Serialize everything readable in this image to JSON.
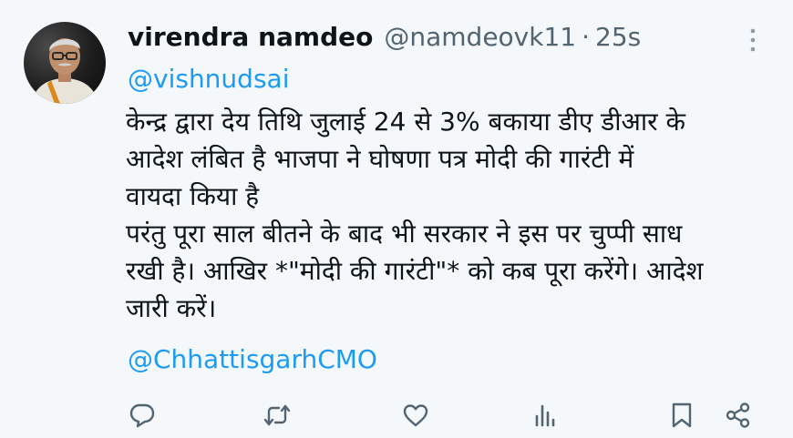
{
  "tweet": {
    "author_name": "virendra namdeo",
    "handle": "@namdeovk11",
    "separator": "·",
    "time": "25s",
    "mention_top": "@vishnudsai",
    "body_lines": [
      " केन्द्र द्वारा देय तिथि जुलाई 24 से 3% बकाया डीए डीआर के",
      "आदेश लंबित है भाजपा ने घोषणा पत्र मोदी की गारंटी में",
      "वायदा किया है",
      "परंतु पूरा साल बीतने के बाद भी सरकार ने इस पर चुप्पी साध",
      "रखी है। आखिर *\"मोदी की गारंटी\"* को कब पूरा करेंगे। आदेश",
      "जारी करें।"
    ],
    "mention_bottom": "@ChhattisgarhCMO"
  },
  "actions": {
    "icons": [
      "reply-icon",
      "retweet-icon",
      "like-icon",
      "views-icon",
      "bookmark-icon",
      "share-icon"
    ]
  },
  "colors": {
    "background": "#f4f8fb",
    "text": "#0f1419",
    "secondary": "#536471",
    "link": "#1d9bf0"
  }
}
